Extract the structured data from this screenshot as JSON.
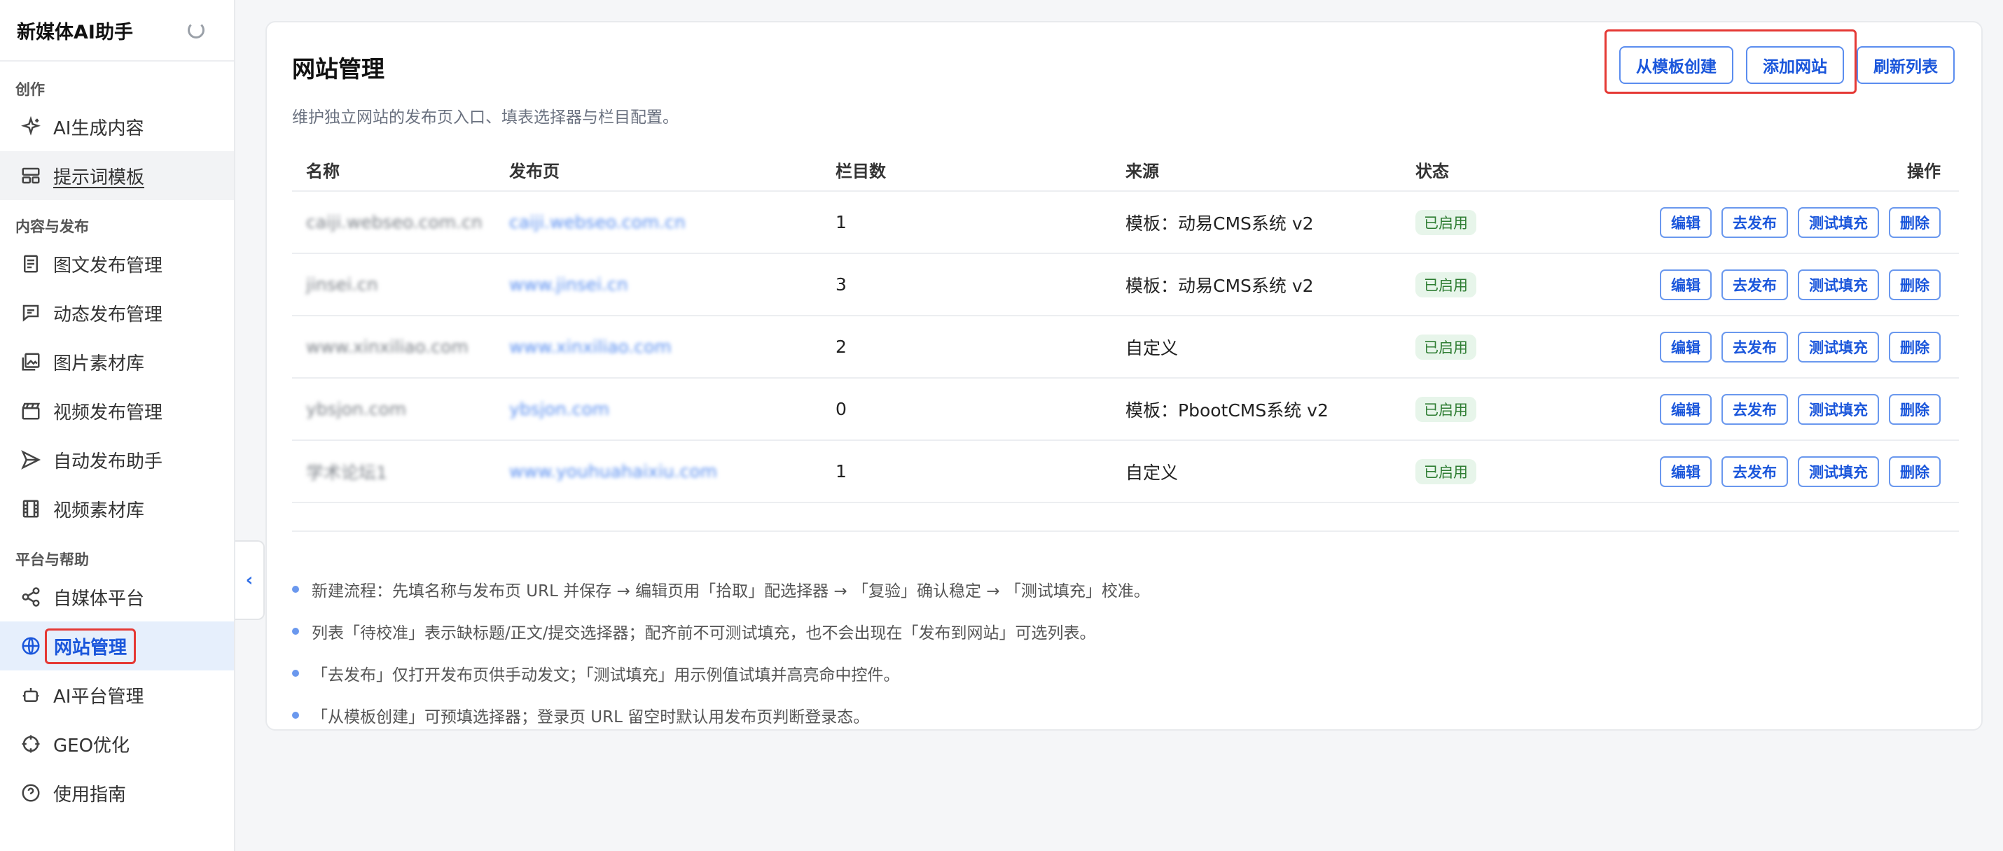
{
  "sidebar": {
    "brand": "新媒体AI助手",
    "groups": [
      {
        "label": "创作",
        "items": [
          {
            "label": "AI生成内容",
            "icon": "sparkle-icon"
          },
          {
            "label": "提示词模板",
            "icon": "layout-icon"
          }
        ]
      },
      {
        "label": "内容与发布",
        "items": [
          {
            "label": "图文发布管理",
            "icon": "article-icon"
          },
          {
            "label": "动态发布管理",
            "icon": "message-icon"
          },
          {
            "label": "图片素材库",
            "icon": "image-icon"
          },
          {
            "label": "视频发布管理",
            "icon": "clapper-icon"
          },
          {
            "label": "自动发布助手",
            "icon": "send-icon"
          },
          {
            "label": "视频素材库",
            "icon": "film-icon"
          }
        ]
      },
      {
        "label": "平台与帮助",
        "items": [
          {
            "label": "自媒体平台",
            "icon": "share-icon"
          },
          {
            "label": "网站管理",
            "icon": "globe-icon"
          },
          {
            "label": "AI平台管理",
            "icon": "robot-icon"
          },
          {
            "label": "GEO优化",
            "icon": "target-icon"
          },
          {
            "label": "使用指南",
            "icon": "help-icon"
          }
        ]
      }
    ],
    "collapse_glyph": "‹"
  },
  "main": {
    "title": "网站管理",
    "description": "维护独立网站的发布页入口、填表选择器与栏目配置。",
    "toolbar": {
      "from_template": "从模板创建",
      "add_site": "添加网站",
      "refresh": "刷新列表"
    },
    "table": {
      "headers": [
        "名称",
        "发布页",
        "栏目数",
        "来源",
        "状态",
        "操作"
      ],
      "rows": [
        {
          "name": "caiji.webseo.com.cn",
          "url": "caiji.webseo.com.cn",
          "columns": "1",
          "source": "模板：动易CMS系统 v2",
          "status": "已启用"
        },
        {
          "name": "jinsei.cn",
          "url": "www.jinsei.cn",
          "columns": "3",
          "source": "模板：动易CMS系统 v2",
          "status": "已启用"
        },
        {
          "name": "www.xinxiliao.com",
          "url": "www.xinxiliao.com",
          "columns": "2",
          "source": "自定义",
          "status": "已启用"
        },
        {
          "name": "ybsjon.com",
          "url": "ybsjon.com",
          "columns": "0",
          "source": "模板：PbootCMS系统 v2",
          "status": "已启用"
        },
        {
          "name": "学术论坛1",
          "url": "www.youhuahaixiu.com",
          "columns": "1",
          "source": "自定义",
          "status": "已启用"
        }
      ],
      "actions": {
        "edit": "编辑",
        "publish": "去发布",
        "test": "测试填充",
        "delete": "删除"
      }
    },
    "notes": [
      "新建流程：先填名称与发布页 URL 并保存 → 编辑页用「拾取」配选择器 → 「复验」确认稳定 → 「测试填充」校准。",
      "列表「待校准」表示缺标题/正文/提交选择器；配齐前不可测试填充，也不会出现在「发布到网站」可选列表。",
      "「去发布」仅打开发布页供手动发文；「测试填充」用示例值试填并高亮命中控件。",
      "「从模板创建」可预填选择器；登录页 URL 留空时默认用发布页判断登录态。"
    ]
  }
}
